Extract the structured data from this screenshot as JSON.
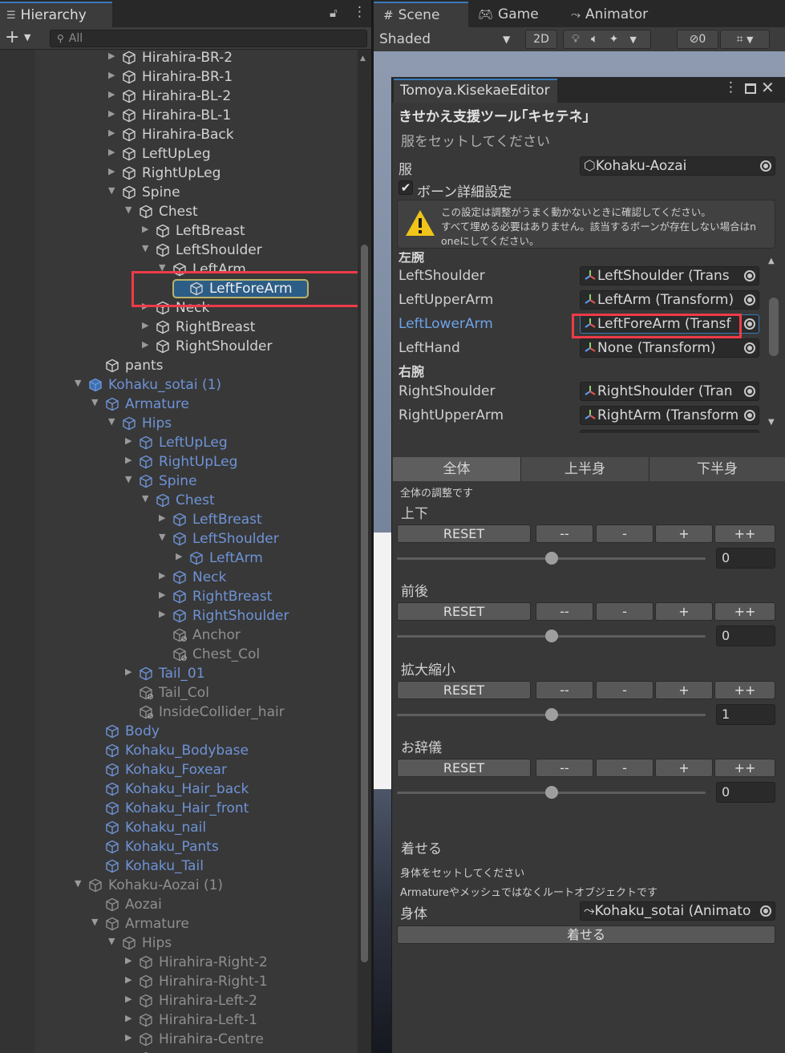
{
  "hierarchy": {
    "tab_label": "Hierarchy",
    "search_placeholder": "All",
    "rows": [
      {
        "label": "Hirahira-BR-2",
        "depth": 5,
        "arrow": "right",
        "color": "default"
      },
      {
        "label": "Hirahira-BR-1",
        "depth": 5,
        "arrow": "right",
        "color": "default"
      },
      {
        "label": "Hirahira-BL-2",
        "depth": 5,
        "arrow": "right",
        "color": "default"
      },
      {
        "label": "Hirahira-BL-1",
        "depth": 5,
        "arrow": "right",
        "color": "default"
      },
      {
        "label": "Hirahira-Back",
        "depth": 5,
        "arrow": "right",
        "color": "default"
      },
      {
        "label": "LeftUpLeg",
        "depth": 5,
        "arrow": "right",
        "color": "default"
      },
      {
        "label": "RightUpLeg",
        "depth": 5,
        "arrow": "right",
        "color": "default"
      },
      {
        "label": "Spine",
        "depth": 5,
        "arrow": "down",
        "color": "default"
      },
      {
        "label": "Chest",
        "depth": 6,
        "arrow": "down",
        "color": "default"
      },
      {
        "label": "LeftBreast",
        "depth": 7,
        "arrow": "right",
        "color": "default"
      },
      {
        "label": "LeftShoulder",
        "depth": 7,
        "arrow": "down",
        "color": "default"
      },
      {
        "label": "LeftArm",
        "depth": 8,
        "arrow": "down",
        "color": "default"
      },
      {
        "label": "LeftForeArm",
        "depth": 9,
        "arrow": "none",
        "color": "default",
        "selected": true
      },
      {
        "label": "Neck",
        "depth": 7,
        "arrow": "right",
        "color": "default"
      },
      {
        "label": "RightBreast",
        "depth": 7,
        "arrow": "right",
        "color": "default"
      },
      {
        "label": "RightShoulder",
        "depth": 7,
        "arrow": "right",
        "color": "default"
      },
      {
        "label": "pants",
        "depth": 4,
        "arrow": "none",
        "color": "default"
      },
      {
        "label": "Kohaku_sotai (1)",
        "depth": 3,
        "arrow": "down",
        "color": "prefab",
        "root": true
      },
      {
        "label": "Armature",
        "depth": 4,
        "arrow": "down",
        "color": "prefab"
      },
      {
        "label": "Hips",
        "depth": 5,
        "arrow": "down",
        "color": "prefab"
      },
      {
        "label": "LeftUpLeg",
        "depth": 6,
        "arrow": "right",
        "color": "prefab"
      },
      {
        "label": "RightUpLeg",
        "depth": 6,
        "arrow": "right",
        "color": "prefab"
      },
      {
        "label": "Spine",
        "depth": 6,
        "arrow": "down",
        "color": "prefab"
      },
      {
        "label": "Chest",
        "depth": 7,
        "arrow": "down",
        "color": "prefab"
      },
      {
        "label": "LeftBreast",
        "depth": 8,
        "arrow": "right",
        "color": "prefab"
      },
      {
        "label": "LeftShoulder",
        "depth": 8,
        "arrow": "down",
        "color": "prefab"
      },
      {
        "label": "LeftArm",
        "depth": 9,
        "arrow": "right",
        "color": "prefab"
      },
      {
        "label": "Neck",
        "depth": 8,
        "arrow": "right",
        "color": "prefab"
      },
      {
        "label": "RightBreast",
        "depth": 8,
        "arrow": "right",
        "color": "prefab"
      },
      {
        "label": "RightShoulder",
        "depth": 8,
        "arrow": "right",
        "color": "prefab"
      },
      {
        "label": "Anchor",
        "depth": 8,
        "arrow": "none",
        "color": "disabled",
        "gear": true
      },
      {
        "label": "Chest_Col",
        "depth": 8,
        "arrow": "none",
        "color": "disabled",
        "gear": true
      },
      {
        "label": "Tail_01",
        "depth": 6,
        "arrow": "right",
        "color": "prefab"
      },
      {
        "label": "Tail_Col",
        "depth": 6,
        "arrow": "none",
        "color": "disabled",
        "gear": true
      },
      {
        "label": "InsideCollider_hair",
        "depth": 6,
        "arrow": "none",
        "color": "disabled",
        "gear": true
      },
      {
        "label": "Body",
        "depth": 4,
        "arrow": "none",
        "color": "prefab"
      },
      {
        "label": "Kohaku_Bodybase",
        "depth": 4,
        "arrow": "none",
        "color": "prefab"
      },
      {
        "label": "Kohaku_Foxear",
        "depth": 4,
        "arrow": "none",
        "color": "prefab"
      },
      {
        "label": "Kohaku_Hair_back",
        "depth": 4,
        "arrow": "none",
        "color": "prefab"
      },
      {
        "label": "Kohaku_Hair_front",
        "depth": 4,
        "arrow": "none",
        "color": "prefab"
      },
      {
        "label": "Kohaku_nail",
        "depth": 4,
        "arrow": "none",
        "color": "prefab"
      },
      {
        "label": "Kohaku_Pants",
        "depth": 4,
        "arrow": "none",
        "color": "prefab"
      },
      {
        "label": "Kohaku_Tail",
        "depth": 4,
        "arrow": "none",
        "color": "prefab"
      },
      {
        "label": "Kohaku-Aozai (1)",
        "depth": 3,
        "arrow": "down",
        "color": "disabled"
      },
      {
        "label": "Aozai",
        "depth": 4,
        "arrow": "none",
        "color": "disabled"
      },
      {
        "label": "Armature",
        "depth": 4,
        "arrow": "down",
        "color": "disabled"
      },
      {
        "label": "Hips",
        "depth": 5,
        "arrow": "down",
        "color": "disabled"
      },
      {
        "label": "Hirahira-Right-2",
        "depth": 6,
        "arrow": "right",
        "color": "disabled"
      },
      {
        "label": "Hirahira-Right-1",
        "depth": 6,
        "arrow": "right",
        "color": "disabled"
      },
      {
        "label": "Hirahira-Left-2",
        "depth": 6,
        "arrow": "right",
        "color": "disabled"
      },
      {
        "label": "Hirahira-Left-1",
        "depth": 6,
        "arrow": "right",
        "color": "disabled"
      },
      {
        "label": "Hirahira-Centre",
        "depth": 6,
        "arrow": "right",
        "color": "disabled"
      },
      {
        "label": "",
        "depth": 6,
        "arrow": "none",
        "color": "disabled"
      }
    ]
  },
  "scene": {
    "tabs": {
      "scene": "Scene",
      "game": "Game",
      "animator": "Animator"
    },
    "shading_mode": "Shaded",
    "toggle_2d": "2D",
    "hidden_count": "0"
  },
  "editor": {
    "window_title": "Tomoya.KisekaeEditor",
    "tool_title": "きせかえ支援ツール｢キセテネ｣",
    "prompt_clothes": "服をセットしてください",
    "clothes_label": "服",
    "clothes_value": "Kohaku-Aozai",
    "bone_detail_label": "ボーン詳細設定",
    "bone_detail_checked": true,
    "warning_lines": [
      "この設定は調整がうまく動かないときに確認してください。",
      "すべて埋める必要はありません。該当するボーンが存在しない場合はn",
      "oneにしてください。"
    ],
    "left_arm_header": "左腕",
    "right_arm_header": "右腕",
    "bones": [
      {
        "name": "LeftShoulder",
        "value": "LeftShoulder (Trans",
        "highlight": false
      },
      {
        "name": "LeftUpperArm",
        "value": "LeftArm (Transform)",
        "highlight": false
      },
      {
        "name": "LeftLowerArm",
        "value": "LeftForeArm (Transf",
        "highlight": true
      },
      {
        "name": "LeftHand",
        "value": "None (Transform)",
        "highlight": false
      },
      {
        "name": "RightShoulder",
        "value": "RightShoulder (Tran",
        "highlight": false
      },
      {
        "name": "RightUpperArm",
        "value": "RightArm (Transform",
        "highlight": false
      }
    ],
    "tabs": [
      "全体",
      "上半身",
      "下半身"
    ],
    "active_tab": 0,
    "section_note": "全体の調整です",
    "adjusters": [
      {
        "label": "上下",
        "value": "0",
        "level": 0.5
      },
      {
        "label": "前後",
        "value": "0",
        "level": 0.5
      },
      {
        "label": "拡大縮小",
        "value": "1",
        "level": 0.5
      },
      {
        "label": "お辞儀",
        "value": "0",
        "level": 0.5
      }
    ],
    "buttons": {
      "reset": "RESET",
      "mm": "--",
      "m": "-",
      "p": "+",
      "pp": "++"
    },
    "wear_header": "着せる",
    "wear_note1": "身体をセットしてください",
    "wear_note2": "Armatureやメッシュではなくルートオブジェクトです",
    "body_label": "身体",
    "body_value": "Kohaku_sotai (Animato",
    "wear_button": "着せる"
  },
  "colors": {
    "selection": "#2c5d87",
    "prefab_text": "#6e93d6",
    "highlight_red": "#ef3b48",
    "accent_blue": "#3a79bb"
  }
}
